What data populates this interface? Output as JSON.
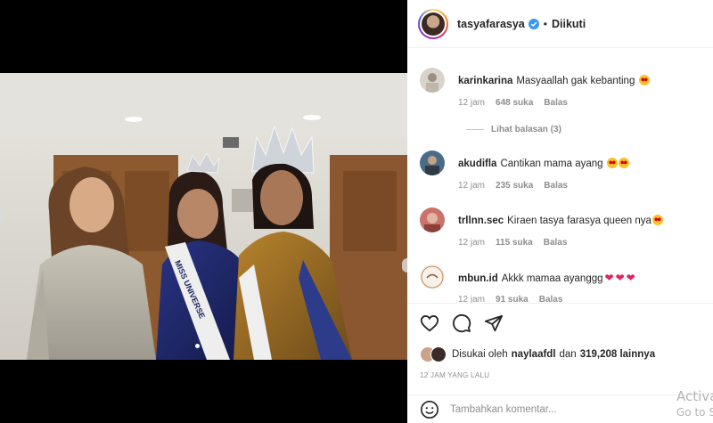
{
  "post": {
    "username": "tasyafarasya",
    "follow_status": "Diikuti",
    "separator": "•"
  },
  "comments": [
    {
      "user": "karinkarina",
      "text": "Masyaallah gak kebanting",
      "time": "12 jam",
      "likes": "648 suka",
      "reply": "Balas",
      "view_replies": "Lihat balasan (3)"
    },
    {
      "user": "akudifla",
      "text": "Cantikan mama ayang",
      "time": "12 jam",
      "likes": "235 suka",
      "reply": "Balas"
    },
    {
      "user": "trllnn.sec",
      "text": "Kiraen tasya farasya queen nya",
      "time": "12 jam",
      "likes": "115 suka",
      "reply": "Balas"
    },
    {
      "user": "mbun.id",
      "text": "Akkk mamaa ayanggg",
      "time": "12 jam",
      "likes": "91 suka",
      "reply": "Balas"
    }
  ],
  "likes": {
    "prefix": "Disukai oleh",
    "user": "naylaafdl",
    "conjunction": "dan",
    "count": "319,208 lainnya"
  },
  "timestamp": "12 jam yang lalu",
  "composer": {
    "placeholder": "Tambahkan komentar..."
  },
  "watermark": {
    "line1": "Activa",
    "line2": "Go to S"
  },
  "icons": {
    "like": "heart-icon",
    "comment": "comment-icon",
    "share": "share-icon",
    "emoji": "emoji-icon",
    "verified": "verified-badge-icon"
  },
  "colors": {
    "verified": "#3897f0",
    "heart": "#e0245e",
    "meta_text": "#8e8e8e"
  }
}
